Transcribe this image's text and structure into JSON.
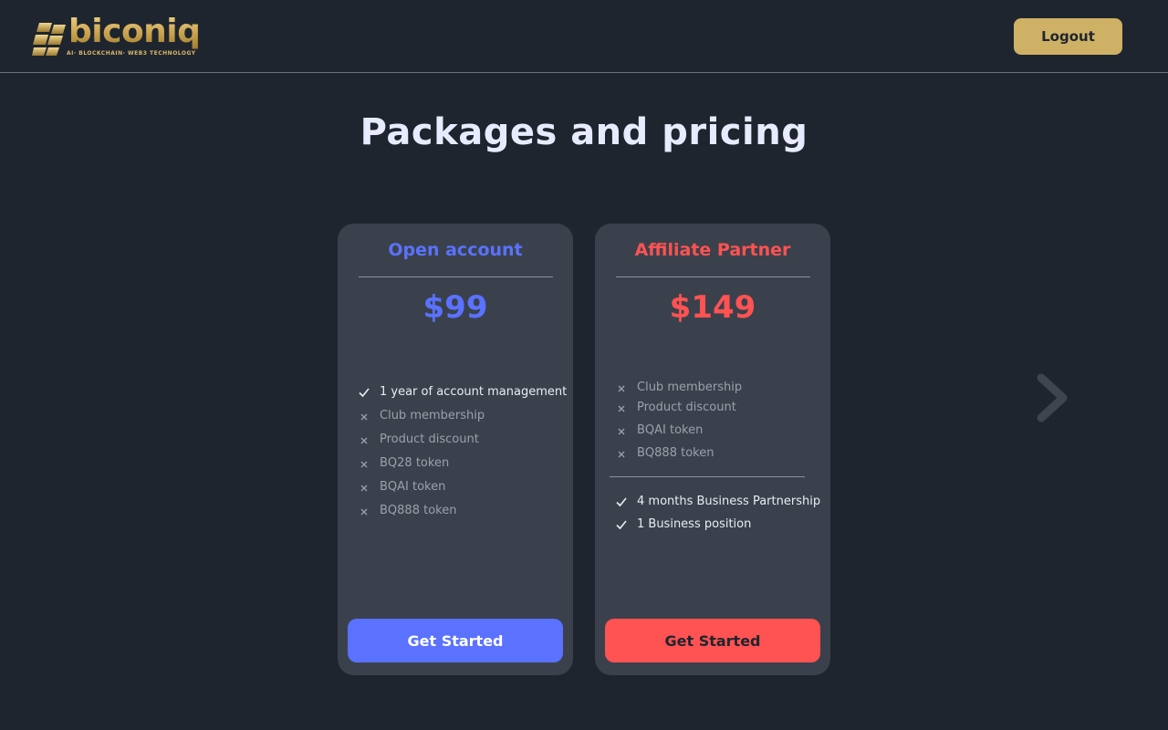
{
  "brand": {
    "name": "biconiq",
    "tagline": "AI· BLOCKCHAIN· WEB3 TECHNOLOGY",
    "gold": "#cfb166"
  },
  "header": {
    "logout_label": "Logout"
  },
  "page": {
    "title": "Packages and pricing"
  },
  "packages": [
    {
      "name": "Open account",
      "price": "$99",
      "accent": "#5a72ff",
      "features": [
        {
          "label": "1 year of account management",
          "included": true,
          "icon": "check-icon"
        },
        {
          "label": "Club membership",
          "included": false,
          "icon": "cross-icon"
        },
        {
          "label": "Product discount",
          "included": false,
          "icon": "cross-icon"
        },
        {
          "label": "BQ28 token",
          "included": false,
          "icon": "cross-icon"
        },
        {
          "label": "BQAI token",
          "included": false,
          "icon": "cross-icon"
        },
        {
          "label": "BQ888 token",
          "included": false,
          "icon": "cross-icon"
        }
      ],
      "cta_label": "Get Started"
    },
    {
      "name": "Affiliate Partner",
      "price": "$149",
      "accent": "#ff5252",
      "features": [
        {
          "label": "Club membership",
          "included": false,
          "icon": "cross-icon"
        },
        {
          "label": "Product discount",
          "included": false,
          "icon": "cross-icon"
        },
        {
          "label": "BQAI token",
          "included": false,
          "icon": "cross-icon"
        },
        {
          "label": "BQ888 token",
          "included": false,
          "icon": "cross-icon"
        }
      ],
      "extras": [
        {
          "label": "4 months Business Partnership",
          "included": true,
          "icon": "check-icon"
        },
        {
          "label": "1  Business position",
          "included": true,
          "icon": "check-icon"
        }
      ],
      "cta_label": "Get Started"
    }
  ],
  "carousel": {
    "next_icon": "chevron-right-icon"
  }
}
